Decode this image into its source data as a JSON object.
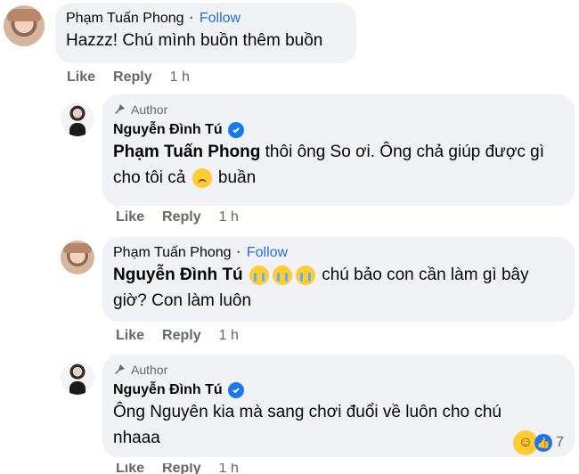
{
  "comments": [
    {
      "name": "Phạm Tuấn Phong",
      "follow": "Follow",
      "text": "Hazzz! Chú mình buồn thêm buồn",
      "actions": {
        "like": "Like",
        "reply": "Reply",
        "time": "1 h"
      }
    },
    {
      "author_label": "Author",
      "name": "Nguyễn Đình Tú",
      "mention": "Phạm Tuấn Phong",
      "text_before_emoji": " thôi ông So ơi. Ông chả giúp được gì cho tôi cả",
      "text_after_emoji": " buần",
      "actions": {
        "like": "Like",
        "reply": "Reply",
        "time": "1 h"
      }
    },
    {
      "name": "Phạm Tuấn Phong",
      "follow": "Follow",
      "mention": "Nguyễn Đình Tú",
      "text": " chú bảo con cần làm gì bây giờ? Con làm luôn",
      "actions": {
        "like": "Like",
        "reply": "Reply",
        "time": "1 h"
      }
    },
    {
      "author_label": "Author",
      "name": "Nguyễn Đình Tú",
      "text": "Ông Nguyên kia mà sang chơi đuổi về luôn cho chú nhaaa",
      "actions": {
        "like": "Like",
        "reply": "Reply",
        "time": "1 h"
      },
      "reaction_count": "7"
    }
  ],
  "colors": {
    "bubble": "#f0f2f5",
    "follow": "#216fdb",
    "meta": "#65676b",
    "verified": "#1877f2"
  }
}
